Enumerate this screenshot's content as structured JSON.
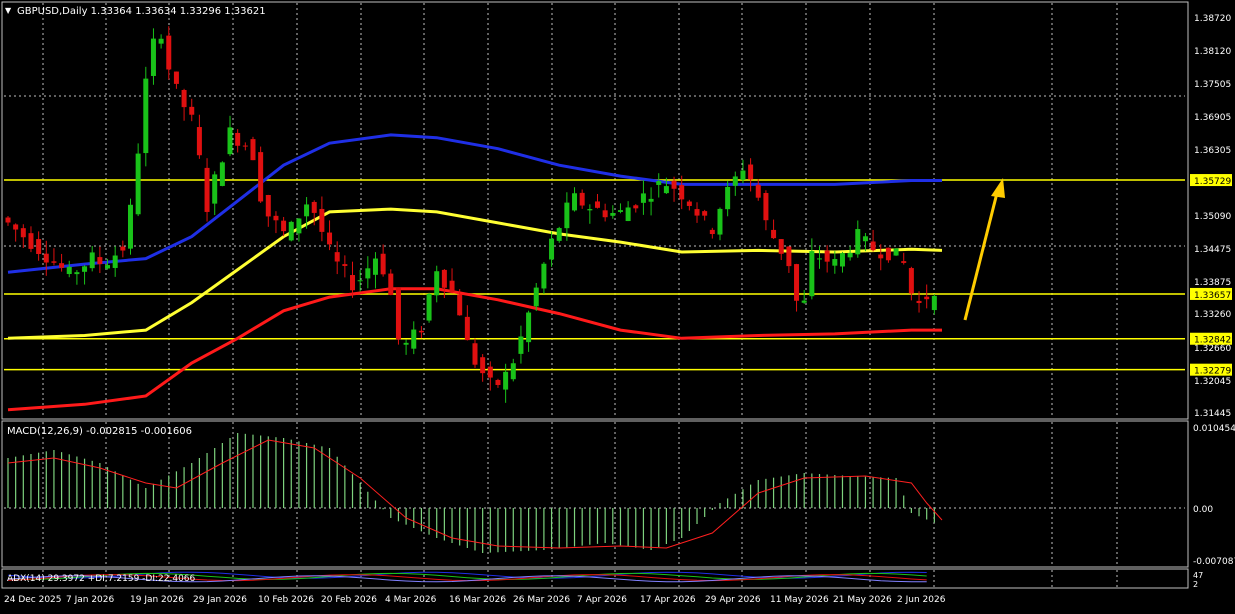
{
  "header": {
    "symbol_text": "GBPUSD,Daily  1.33364 1.33634 1.33296 1.33621"
  },
  "colors": {
    "background": "#000000",
    "grid": "#c0c0c0",
    "bull": "#19c219",
    "bear": "#e01010",
    "ma_blue": "#1f2fe6",
    "ma_yellow": "#ffff33",
    "ma_red": "#ff1a1a",
    "level_line": "#ffff00",
    "arrow": "#ffcc00",
    "axis_text": "#ffffff",
    "macd_hist": "#7ed27e",
    "macd_signal": "#ff2020"
  },
  "price_axis": {
    "labels": [
      "1.38720",
      "1.38120",
      "1.37505",
      "1.36905",
      "1.36305",
      "1.35090",
      "1.34475",
      "1.33875",
      "1.33260",
      "1.32660",
      "1.32045",
      "1.31445"
    ],
    "tags": [
      {
        "value": "1.35729",
        "price": 1.35729
      },
      {
        "value": "1.33657",
        "price": 1.33657
      },
      {
        "value": "1.32842",
        "price": 1.32842
      },
      {
        "value": "1.32279",
        "price": 1.32279
      }
    ]
  },
  "date_axis": {
    "labels": [
      "24 Dec 2025",
      "7 Jan 2026",
      "19 Jan 2026",
      "29 Jan 2026",
      "10 Feb 2026",
      "20 Feb 2026",
      "4 Mar 2026",
      "16 Mar 2026",
      "26 Mar 2026",
      "7 Apr 2026",
      "17 Apr 2026",
      "29 Apr 2026",
      "11 May 2026",
      "21 May 2026",
      "2 Jun 2026"
    ]
  },
  "macd": {
    "label": "MACD(12,26,9) -0.002815 -0.001606",
    "axis_labels": [
      "0.010454",
      "0.00",
      "-0.007087"
    ]
  },
  "adx": {
    "label": "ADX(14) 29.3972 +DI:7.2159 -DI:22.4066",
    "axis_labels": [
      "47",
      "2"
    ]
  },
  "chart_data": {
    "type": "candlestick",
    "symbol": "GBPUSD",
    "timeframe": "Daily",
    "ohlc_last": {
      "open": 1.33364,
      "high": 1.33634,
      "low": 1.33296,
      "close": 1.33621
    },
    "ylim": [
      1.314,
      1.3895
    ],
    "horizontal_levels": [
      1.35729,
      1.33657,
      1.32842,
      1.32279
    ],
    "ma_series": [
      {
        "color": "blue",
        "points": [
          [
            0,
            1.3405
          ],
          [
            10,
            1.342
          ],
          [
            18,
            1.343
          ],
          [
            24,
            1.347
          ],
          [
            30,
            1.3535
          ],
          [
            36,
            1.36
          ],
          [
            42,
            1.364
          ],
          [
            50,
            1.3655
          ],
          [
            56,
            1.365
          ],
          [
            64,
            1.363
          ],
          [
            72,
            1.36
          ],
          [
            80,
            1.358
          ],
          [
            88,
            1.3565
          ],
          [
            98,
            1.3565
          ],
          [
            108,
            1.3565
          ],
          [
            118,
            1.3572
          ],
          [
            122,
            1.3572
          ]
        ]
      },
      {
        "color": "yellow",
        "points": [
          [
            0,
            1.3285
          ],
          [
            10,
            1.329
          ],
          [
            18,
            1.33
          ],
          [
            24,
            1.335
          ],
          [
            30,
            1.341
          ],
          [
            36,
            1.347
          ],
          [
            42,
            1.3515
          ],
          [
            50,
            1.352
          ],
          [
            56,
            1.3515
          ],
          [
            64,
            1.3495
          ],
          [
            72,
            1.3475
          ],
          [
            80,
            1.346
          ],
          [
            88,
            1.3442
          ],
          [
            98,
            1.3445
          ],
          [
            108,
            1.3442
          ],
          [
            118,
            1.3447
          ],
          [
            122,
            1.3445
          ]
        ]
      },
      {
        "color": "red",
        "points": [
          [
            0,
            1.3155
          ],
          [
            10,
            1.3165
          ],
          [
            18,
            1.318
          ],
          [
            24,
            1.324
          ],
          [
            30,
            1.3285
          ],
          [
            36,
            1.3335
          ],
          [
            42,
            1.336
          ],
          [
            50,
            1.3375
          ],
          [
            56,
            1.3375
          ],
          [
            64,
            1.3355
          ],
          [
            72,
            1.333
          ],
          [
            80,
            1.33
          ],
          [
            88,
            1.3285
          ],
          [
            98,
            1.329
          ],
          [
            108,
            1.3293
          ],
          [
            118,
            1.33
          ],
          [
            122,
            1.33
          ]
        ]
      }
    ]
  }
}
